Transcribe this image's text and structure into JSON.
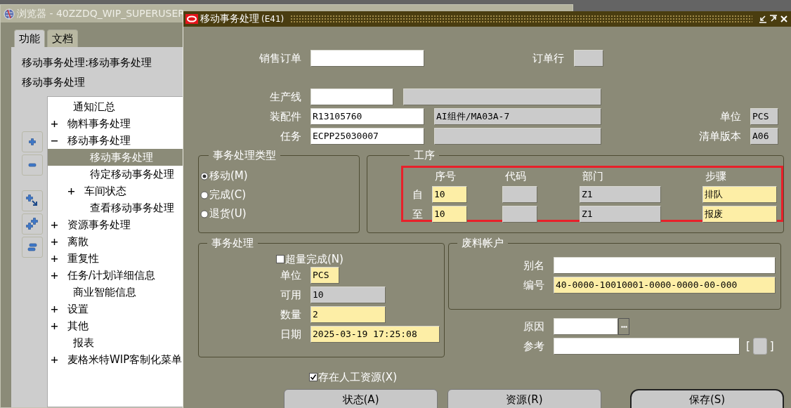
{
  "navigator": {
    "title": "浏览器 - 40ZZDQ_WIP_SUPERUSER",
    "tabs": [
      {
        "label": "功能",
        "selected": true
      },
      {
        "label": "文档",
        "selected": false
      }
    ],
    "path": "移动事务处理:移动事务处理",
    "heading": "移动事务处理",
    "tree": [
      {
        "label": "通知汇总",
        "selected": false
      },
      {
        "label": "物料事务处理",
        "expanded": false,
        "selected": false
      },
      {
        "label": "移动事务处理",
        "expanded": true,
        "selected": false,
        "children": [
          {
            "label": "移动事务处理",
            "selected": true
          },
          {
            "label": "待定移动事务处理",
            "selected": false
          },
          {
            "label": "车间状态",
            "expanded": false,
            "selected": false
          },
          {
            "label": "查看移动事务处理",
            "selected": false
          }
        ]
      },
      {
        "label": "资源事务处理",
        "expanded": false,
        "selected": false
      },
      {
        "label": "离散",
        "expanded": false,
        "selected": false
      },
      {
        "label": "重复性",
        "expanded": false,
        "selected": false
      },
      {
        "label": "任务/计划详细信息",
        "expanded": false,
        "selected": false
      },
      {
        "label": "商业智能信息",
        "selected": false
      },
      {
        "label": "设置",
        "expanded": false,
        "selected": false
      },
      {
        "label": "其他",
        "expanded": false,
        "selected": false
      },
      {
        "label": "报表",
        "selected": false
      },
      {
        "label": "麦格米特WIP客制化菜单",
        "expanded": false,
        "selected": false
      }
    ]
  },
  "form": {
    "title": "移动事务处理",
    "code": "(E41)",
    "sales_order": {
      "label": "销售订单",
      "kind": "editable"
    },
    "order_line": {
      "label": "订单行",
      "kind": "readonly"
    },
    "line": {
      "label": "生产线",
      "kind": "editable",
      "description": {
        "kind": "readonly"
      }
    },
    "assembly": {
      "label": "装配件",
      "value": "R13105760",
      "kind": "editable",
      "description": {
        "value": "AI组件/MA03A-7",
        "kind": "readonly"
      }
    },
    "job": {
      "label": "任务",
      "value": "ECPP25030007",
      "kind": "editable",
      "description": {
        "kind": "readonly"
      }
    },
    "uom": {
      "label": "单位",
      "value": "PCS",
      "kind": "readonly"
    },
    "bom_revision": {
      "label": "清单版本",
      "value": "A06",
      "kind": "readonly"
    },
    "transaction_type": {
      "title": "事务处理类型",
      "options": [
        {
          "label": "移动(M)",
          "selected": true
        },
        {
          "label": "完成(C)",
          "selected": false
        },
        {
          "label": "退货(U)",
          "selected": false
        }
      ]
    },
    "operations": {
      "title": "工序",
      "highlighted": true,
      "columns": [
        "序号",
        "代码",
        "部门",
        "步骤"
      ],
      "rows": [
        {
          "label": "自",
          "cells": [
            {
              "value": "10",
              "kind": "required"
            },
            {
              "kind": "readonly"
            },
            {
              "value": "Z1",
              "kind": "readonly"
            },
            {
              "value": "排队",
              "kind": "required"
            }
          ]
        },
        {
          "label": "至",
          "cells": [
            {
              "value": "10",
              "kind": "required"
            },
            {
              "kind": "readonly"
            },
            {
              "value": "Z1",
              "kind": "readonly"
            },
            {
              "value": "报废",
              "kind": "required"
            }
          ]
        }
      ]
    },
    "transaction": {
      "title": "事务处理",
      "over_complete": {
        "label": "超量完成(N)",
        "checked": false
      },
      "fields": [
        {
          "label": "单位",
          "value": "PCS",
          "kind": "required"
        },
        {
          "label": "可用",
          "value": "10",
          "kind": "readonly"
        },
        {
          "label": "数量",
          "value": "2",
          "kind": "required"
        },
        {
          "label": "日期",
          "value": "2025-03-19 17:25:08",
          "kind": "required"
        }
      ]
    },
    "scrap_account": {
      "title": "废料帐户",
      "fields": [
        {
          "label": "别名",
          "kind": "editable"
        },
        {
          "label": "编号",
          "value": "40-0000-10010001-0000-0000-00-000",
          "kind": "required"
        }
      ]
    },
    "reason": {
      "label": "原因",
      "kind": "editable"
    },
    "reference": {
      "label": "参考",
      "kind": "editable"
    },
    "flexfield": {
      "open": "[",
      "close": "]"
    },
    "labor": {
      "label": "存在人工资源(X)",
      "checked": true
    },
    "buttons": [
      {
        "label": "状态(A)",
        "default": false
      },
      {
        "label": "资源(R)",
        "default": false
      },
      {
        "label": "保存(S)",
        "default": true
      }
    ]
  }
}
